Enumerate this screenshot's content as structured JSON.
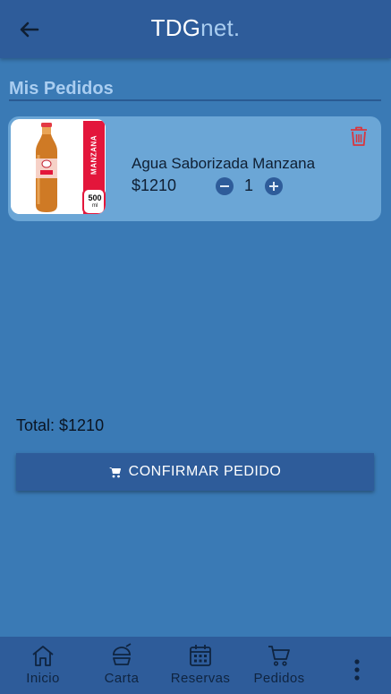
{
  "header": {
    "brand_main": "TDG",
    "brand_accent": "net.",
    "back_icon": "arrow-left-icon"
  },
  "page": {
    "title": "Mis Pedidos"
  },
  "order": {
    "items": [
      {
        "name": "Agua Saborizada Manzana",
        "price": "$1210",
        "quantity": "1",
        "image_label_flavor": "MANZANA",
        "image_label_volume": "500",
        "image_label_unit": "ml"
      }
    ]
  },
  "summary": {
    "total": "Total: $1210",
    "confirm_label": "CONFIRMAR PEDIDO"
  },
  "nav": {
    "items": [
      {
        "label": "Inicio",
        "icon": "home-icon"
      },
      {
        "label": "Carta",
        "icon": "food-icon"
      },
      {
        "label": "Reservas",
        "icon": "calendar-icon"
      },
      {
        "label": "Pedidos",
        "icon": "cart-icon"
      }
    ],
    "more_icon": "more-vertical-icon"
  },
  "colors": {
    "background": "#3a7ab5",
    "bar": "#2e5c9a",
    "card": "#6ba6d6",
    "accent_text": "#a9cdf0",
    "delete": "#d9363e"
  }
}
